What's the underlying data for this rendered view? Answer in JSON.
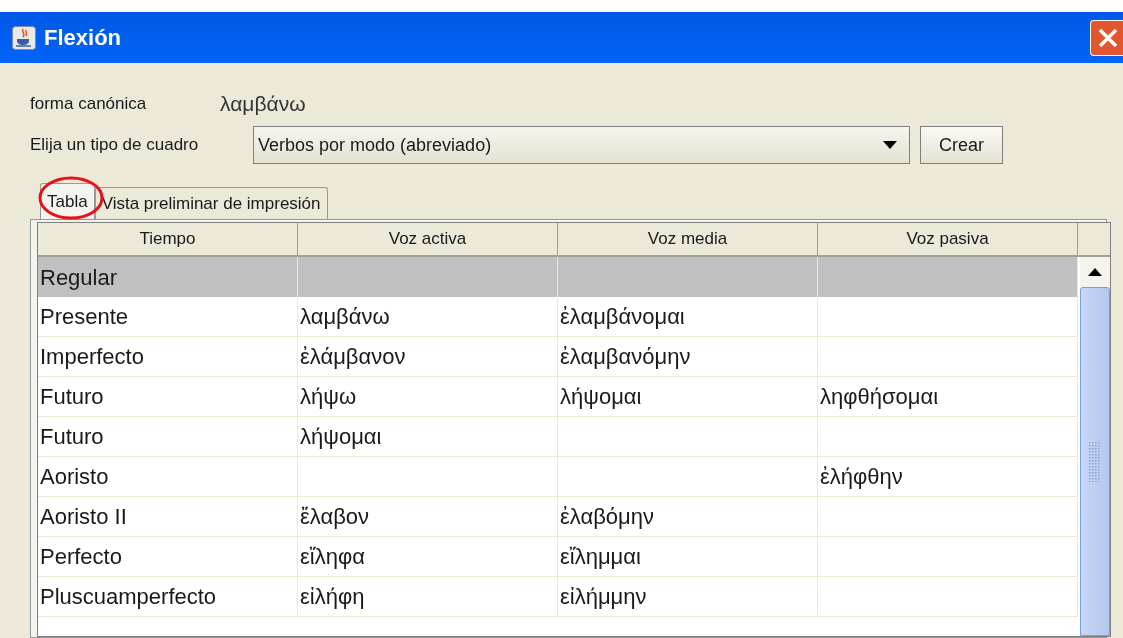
{
  "window": {
    "title": "Flexión"
  },
  "canonical": {
    "label": "forma canónica",
    "value": "λαμβάνω"
  },
  "chart_type": {
    "label": "Elija un tipo de cuadro",
    "value": "Verbos por modo (abreviado)",
    "button": "Crear"
  },
  "tabs": [
    {
      "label": "Tabla",
      "selected": true
    },
    {
      "label": "Vista preliminar de impresión",
      "selected": false
    }
  ],
  "table": {
    "columns": [
      "Tiempo",
      "Voz activa",
      "Voz media",
      "Voz pasiva"
    ],
    "rows": [
      {
        "kind": "group",
        "tiempo": "Regular"
      },
      {
        "kind": "row",
        "tiempo": "Presente",
        "activa": "λαμβάνω",
        "media": "ἐλαμβάνομαι"
      },
      {
        "kind": "row",
        "tiempo": "Imperfecto",
        "activa": "ἐλάμβανον",
        "media": "ἐλαμβανόμην"
      },
      {
        "kind": "row",
        "tiempo": "Futuro",
        "activa": "λήψω",
        "media": "λήψομαι",
        "pasiva": "ληφθήσομαι"
      },
      {
        "kind": "row",
        "tiempo": "Futuro",
        "activa": "λήψομαι"
      },
      {
        "kind": "row",
        "tiempo": "Aoristo",
        "pasiva": "ἐλήφθην"
      },
      {
        "kind": "row",
        "tiempo": "Aoristo II",
        "activa": "ἔλαβον",
        "media": "ἐλαβόμην"
      },
      {
        "kind": "row",
        "tiempo": "Perfecto",
        "activa": "εἴληφα",
        "media": "εἴλημμαι"
      },
      {
        "kind": "row",
        "tiempo": "Pluscuamperfecto",
        "activa": "εἰλήφη",
        "media": "εἰλήμμην"
      }
    ]
  }
}
